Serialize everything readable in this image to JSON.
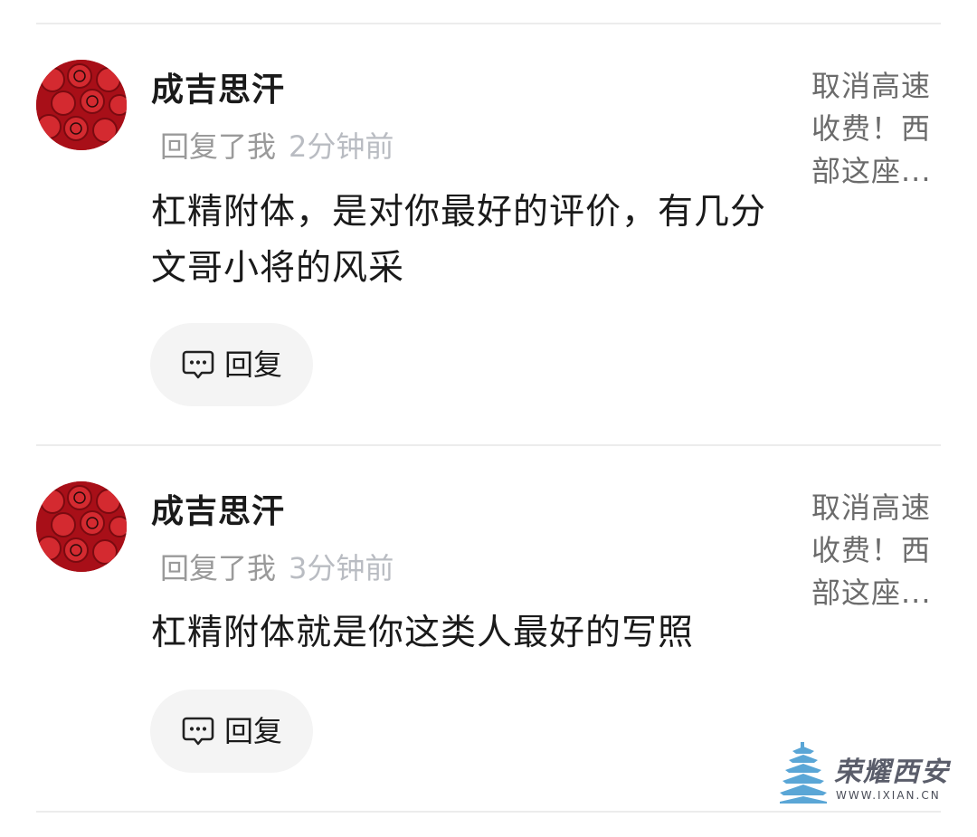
{
  "comments": [
    {
      "username": "成吉思汗",
      "reply_label": "回复了我",
      "time": "2分钟前",
      "content": "杠精附体，是对你最好的评价，有几分文哥小将的风采",
      "reply_button": "回复",
      "quoted_post": "取消高速收费！西部这座..."
    },
    {
      "username": "成吉思汗",
      "reply_label": "回复了我",
      "time": "3分钟前",
      "content": "杠精附体就是你这类人最好的写照",
      "reply_button": "回复",
      "quoted_post": "取消高速收费！西部这座..."
    }
  ],
  "watermark": {
    "name": "荣耀西安",
    "url": "WWW.IXIAN.CN"
  },
  "colors": {
    "avatar_red": "#b3121c",
    "reply_button_bg": "#f4f4f4",
    "time_text": "#b9bcc2",
    "watermark_blue": "#5aa6d6"
  },
  "icons": {
    "reply": "comment-bubble-icon"
  }
}
